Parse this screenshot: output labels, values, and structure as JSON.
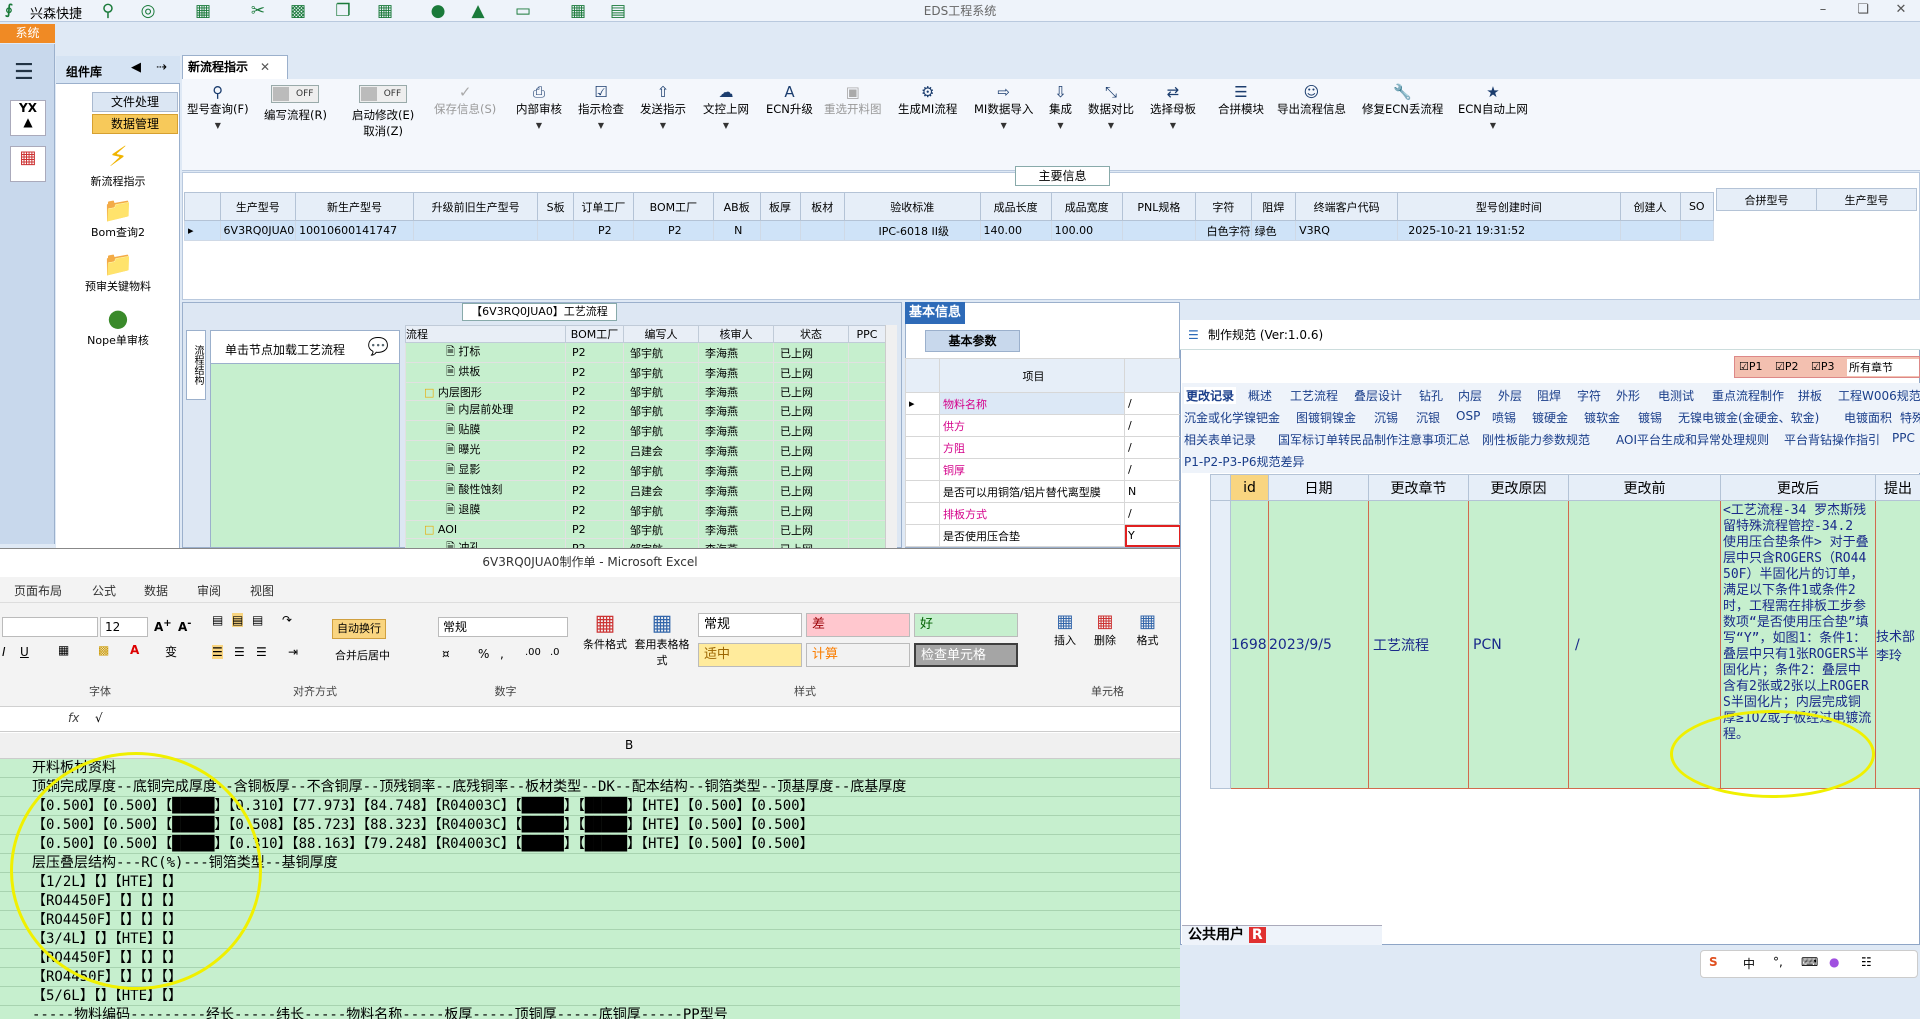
{
  "app": {
    "name": "兴森快捷",
    "window_title": "EDS工程系统",
    "system_tab": "系统"
  },
  "toolbar_icons": [
    "search-icon",
    "help-icon",
    "table-icon",
    "scissors-icon",
    "film-icon",
    "copy-icon",
    "grid-icon",
    "user-icon",
    "chart-icon",
    "monitor-icon",
    "windows-icon",
    "notebook-icon"
  ],
  "library": {
    "title": "组件库",
    "cat1": "文件处理",
    "cat2": "数据管理",
    "items": [
      "新流程指示",
      "Bom查询2",
      "预审关键物料",
      "Nope单审核"
    ]
  },
  "doc_tab": "新流程指示",
  "ribbon": [
    {
      "label": "型号查询(F)",
      "icon": "search-icon"
    },
    {
      "label": "编写流程(R)",
      "icon": "toggle",
      "toggle": "OFF"
    },
    {
      "label": "启动修改(E)",
      "label2": "取消(Z)",
      "icon": "toggle",
      "toggle": "OFF"
    },
    {
      "label": "保存信息(S)",
      "icon": "check-icon",
      "disabled": true
    },
    {
      "label": "内部审核",
      "icon": "print-icon"
    },
    {
      "label": "指示检查",
      "icon": "checkbox-icon"
    },
    {
      "label": "发送指示",
      "icon": "upload-icon"
    },
    {
      "label": "文控上网",
      "icon": "cloud-upload-icon"
    },
    {
      "label": "ECN升级",
      "icon": "letter-a-icon"
    },
    {
      "label": "重选开料图",
      "icon": "image-icon",
      "disabled": true
    },
    {
      "label": "生成MI流程",
      "icon": "gears-icon"
    },
    {
      "label": "MI数据导入",
      "icon": "import-icon"
    },
    {
      "label": "集成",
      "icon": "download-icon"
    },
    {
      "label": "数据对比",
      "icon": "compare-icon"
    },
    {
      "label": "选择母板",
      "icon": "shuffle-icon"
    },
    {
      "label": "合拼模块",
      "icon": "list-icon"
    },
    {
      "label": "导出流程信息",
      "icon": "smile-icon"
    },
    {
      "label": "修复ECN丢流程",
      "icon": "wrench-icon"
    },
    {
      "label": "ECN自动上网",
      "icon": "star-icon"
    }
  ],
  "main_info": {
    "title": "主要信息",
    "headers": [
      "生产型号",
      "新生产型号",
      "升级前旧生产型号",
      "S板",
      "订单工厂",
      "BOM工厂",
      "AB板",
      "板厚",
      "板材",
      "验收标准",
      "成品长度",
      "成品宽度",
      "PNL规格",
      "字符",
      "阻焊",
      "终端客户代码",
      "型号创建时间",
      "创建人",
      "SO"
    ],
    "row": [
      "6V3RQ0JUA0",
      "10010600141747",
      "",
      "",
      "P2",
      "P2",
      "N",
      "",
      "",
      "IPC-6018 II级",
      "140.00",
      "100.00",
      "",
      "白色字符",
      "绿色",
      "V3RQ",
      "2025-10-21 19:31:52",
      "",
      ""
    ],
    "right_headers": [
      "合拼型号",
      "生产型号"
    ]
  },
  "flow_panel": {
    "title": "【6V3RQ0JUA0】工艺流程",
    "side_label": "流程结构",
    "hint": "单击节点加载工艺流程",
    "headers": [
      "流程",
      "BOM工厂",
      "编写人",
      "核审人",
      "状态",
      "PPC"
    ],
    "rows": [
      {
        "name": "打标",
        "indent": 2,
        "factory": "P2",
        "writer": "邹宇航",
        "checker": "李海燕",
        "status": "已上网"
      },
      {
        "name": "烘板",
        "indent": 2,
        "factory": "P2",
        "writer": "邹宇航",
        "checker": "李海燕",
        "status": "已上网"
      },
      {
        "name": "内层图形",
        "indent": 1,
        "folder": true,
        "factory": "P2",
        "writer": "邹宇航",
        "checker": "李海燕",
        "status": "已上网"
      },
      {
        "name": "内层前处理",
        "indent": 2,
        "factory": "P2",
        "writer": "邹宇航",
        "checker": "李海燕",
        "status": "已上网"
      },
      {
        "name": "贴膜",
        "indent": 2,
        "factory": "P2",
        "writer": "邹宇航",
        "checker": "李海燕",
        "status": "已上网"
      },
      {
        "name": "曝光",
        "indent": 2,
        "factory": "P2",
        "writer": "吕建会",
        "checker": "李海燕",
        "status": "已上网"
      },
      {
        "name": "显影",
        "indent": 2,
        "factory": "P2",
        "writer": "邹宇航",
        "checker": "李海燕",
        "status": "已上网"
      },
      {
        "name": "酸性蚀刻",
        "indent": 2,
        "factory": "P2",
        "writer": "吕建会",
        "checker": "李海燕",
        "status": "已上网"
      },
      {
        "name": "退膜",
        "indent": 2,
        "factory": "P2",
        "writer": "邹宇航",
        "checker": "李海燕",
        "status": "已上网"
      },
      {
        "name": "AOI",
        "indent": 1,
        "folder": true,
        "factory": "P2",
        "writer": "邹宇航",
        "checker": "李海燕",
        "status": "已上网"
      },
      {
        "name": "冲孔",
        "indent": 2,
        "factory": "P2",
        "writer": "邹宇航",
        "checker": "李海燕",
        "status": "已上网"
      }
    ]
  },
  "basic_info": {
    "title": "基本信息",
    "sub": "基本参数",
    "col": "项目",
    "rows": [
      {
        "k": "物料名称",
        "v": "/",
        "red": true
      },
      {
        "k": "供方",
        "v": "/",
        "red": true
      },
      {
        "k": "方阻",
        "v": "/",
        "red": true
      },
      {
        "k": "铜厚",
        "v": "/",
        "red": true
      },
      {
        "k": "是否可以用铜箔/铝片替代离型膜",
        "v": "N",
        "red": false
      },
      {
        "k": "排板方式",
        "v": "/",
        "red": true
      },
      {
        "k": "是否使用压合垫",
        "v": "Y",
        "red": false
      }
    ]
  },
  "excel": {
    "title": "6V3RQ0JUA0制作单 - Microsoft Excel",
    "menu": [
      "页面布局",
      "公式",
      "数据",
      "审阅",
      "视图"
    ],
    "font_size": "12",
    "wrap": "自动换行",
    "merge": "合并后居中",
    "number_format": "常规",
    "styles": {
      "normal": "常规",
      "bad": "差",
      "good": "好",
      "neutral": "适中",
      "calc": "计算",
      "check": "检查单元格"
    },
    "groups": {
      "font": "字体",
      "align": "对齐方式",
      "number": "数字",
      "style": "样式",
      "cells": "单元格"
    },
    "cond_format": "条件格式",
    "table_format": "套用表格格式",
    "insert": "插入",
    "delete": "删除",
    "format": "格式",
    "fx": "fx",
    "formula": "√",
    "column": "B",
    "rows": [
      "开料板材资料",
      "顶铜完成厚度--底铜完成厚度--含铜板厚--不含铜厚--顶残铜率--底残铜率--板材类型--DK--配本结构--铜箔类型--顶基厚度--底基厚度",
      "【0.500】【0.500】【█████】【0.310】【77.973】【84.748】【R04003C】【█████】【█████】【HTE】【0.500】【0.500】",
      "【0.500】【0.500】【█████】【0.508】【85.723】【88.323】【R04003C】【█████】【█████】【HTE】【0.500】【0.500】",
      "【0.500】【0.500】【█████】【0.310】【88.163】【79.248】【R04003C】【█████】【█████】【HTE】【0.500】【0.500】",
      "层压叠层结构---RC(%)---铜箔类型--基铜厚度",
      "【1/2L】【】【HTE】【】",
      "【RO4450F】【】【】【】",
      "【RO4450F】【】【】【】",
      "【3/4L】【】【HTE】【】",
      "【RO4450F】【】【】【】",
      "【RO4450F】【】【】【】",
      "【5/6L】【】【HTE】【】",
      "-----物料编码---------经长-----纬长-----物料名称-----板厚-----顶铜厚-----底铜厚-----PP型号"
    ]
  },
  "dialog": {
    "title": "制作规范 (Ver:1.0.6)",
    "filters": [
      "P1",
      "P2",
      "P3"
    ],
    "chapter": "所有章节",
    "tabs1": [
      "更改记录",
      "概述",
      "工艺流程",
      "叠层设计",
      "钻孔",
      "内层",
      "外层",
      "阻焊",
      "字符",
      "外形",
      "电测试",
      "重点流程制作",
      "拼板",
      "工程W006规范"
    ],
    "tabs2": [
      "沉金或化学镍钯金",
      "图镀铜镍金",
      "沉锡",
      "沉银",
      "OSP",
      "喷锡",
      "镀硬金",
      "镀软金",
      "镀锡",
      "无镍电镀金(金硬金、软金)",
      "电镀面积",
      "特殊"
    ],
    "tabs3": [
      "相关表单记录",
      "国军标订单转民品制作注意事项汇总",
      "刚性板能力参数规范",
      "AOI平台生成和异常处理规则",
      "平台背钻操作指引",
      "PPC"
    ],
    "tabs4": [
      "P1-P2-P3-P6规范差异"
    ],
    "headers": [
      "id",
      "日期",
      "更改章节",
      "更改原因",
      "更改前",
      "更改后",
      "提出"
    ],
    "row": {
      "id": "1698",
      "date": "2023/9/5",
      "chapter": "工艺流程",
      "reason": "PCN",
      "before": "/",
      "after": "<工艺流程-34 罗杰斯残留特殊流程管控-34.2 使用压合垫条件> 对于叠层中只含ROGERS（RO4450F）半固化片的订单，满足以下条件1或条件2时，工程需在排板工步参数项“是否使用压合垫”填写“Y”，如图1：条件1：叠层中只有1张ROGERS半固化片；条件2：叠层中含有2张或2张以上ROGERS半固化片；内层完成铜厚≥1OZ或子板经过电镀流程。",
      "proposer": "技术部 李玲"
    },
    "status_user": "公共用户",
    "status_r": "R"
  },
  "ime": {
    "items": [
      "S",
      "中",
      "°,",
      "键盘",
      "皮肤",
      "工具"
    ]
  }
}
